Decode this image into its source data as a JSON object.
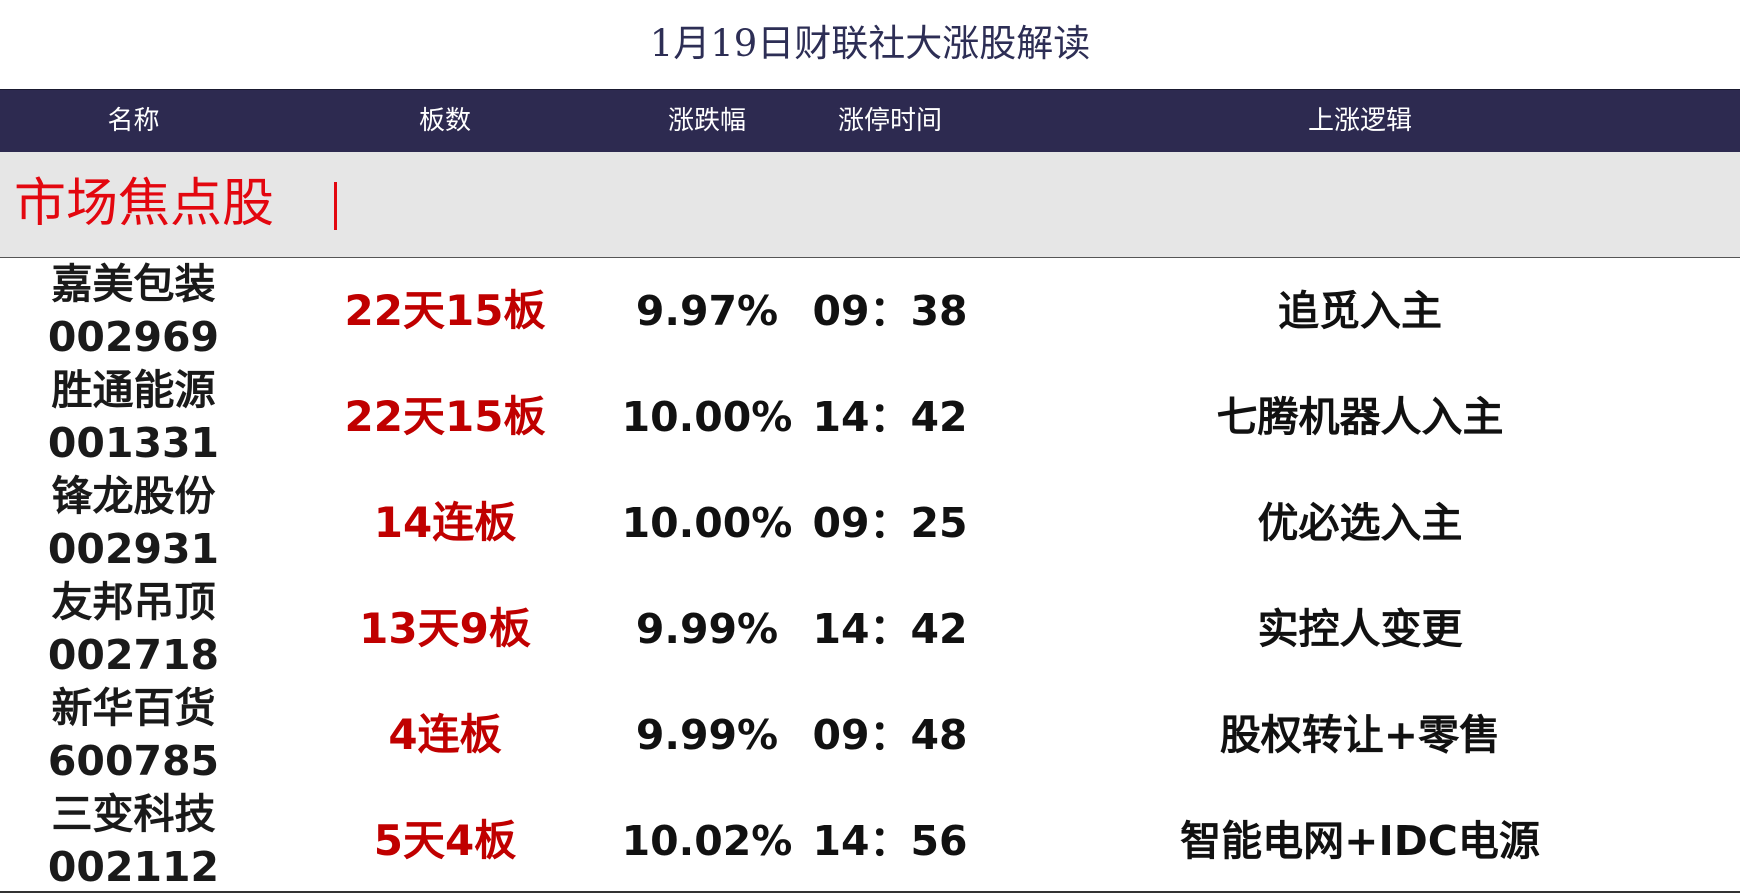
{
  "title": "1月19日财联社大涨股解读",
  "columns": {
    "name": "名称",
    "boards": "板数",
    "change": "涨跌幅",
    "limit_time": "涨停时间",
    "logic": "上涨逻辑"
  },
  "section": {
    "title": "市场焦点股"
  },
  "rows": [
    {
      "name": "嘉美包装",
      "code": "002969",
      "boards": "22天15板",
      "change": "9.97%",
      "limit_time": "09：38",
      "logic": "追觅入主"
    },
    {
      "name": "胜通能源",
      "code": "001331",
      "boards": "22天15板",
      "change": "10.00%",
      "limit_time": "14：42",
      "logic": "七腾机器人入主"
    },
    {
      "name": "锋龙股份",
      "code": "002931",
      "boards": "14连板",
      "change": "10.00%",
      "limit_time": "09：25",
      "logic": "优必选入主"
    },
    {
      "name": "友邦吊顶",
      "code": "002718",
      "boards": "13天9板",
      "change": "9.99%",
      "limit_time": "14：42",
      "logic": "实控人变更"
    },
    {
      "name": "新华百货",
      "code": "600785",
      "boards": "4连板",
      "change": "9.99%",
      "limit_time": "09：48",
      "logic": "股权转让+零售"
    },
    {
      "name": "三变科技",
      "code": "002112",
      "boards": "5天4板",
      "change": "10.02%",
      "limit_time": "14：56",
      "logic": "智能电网+IDC电源"
    }
  ],
  "colors": {
    "header_bg": "#2d2a50",
    "header_text": "#ffffff",
    "accent_red": "#c00000",
    "section_red": "#e3070f",
    "section_bg": "#e6e6e6"
  }
}
